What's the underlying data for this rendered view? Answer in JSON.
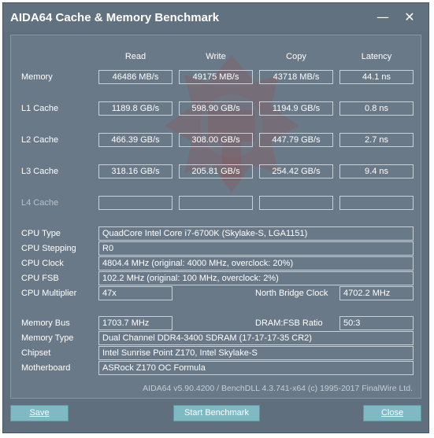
{
  "window": {
    "title": "AIDA64 Cache & Memory Benchmark",
    "minimize_glyph": "—",
    "close_glyph": "✕"
  },
  "columns": [
    "Read",
    "Write",
    "Copy",
    "Latency"
  ],
  "rows": [
    {
      "label": "Memory",
      "read": "46486 MB/s",
      "write": "49175 MB/s",
      "copy": "43718 MB/s",
      "latency": "44.1 ns"
    },
    {
      "label": "L1 Cache",
      "read": "1189.8 GB/s",
      "write": "598.90 GB/s",
      "copy": "1194.9 GB/s",
      "latency": "0.8 ns"
    },
    {
      "label": "L2 Cache",
      "read": "466.39 GB/s",
      "write": "308.00 GB/s",
      "copy": "447.79 GB/s",
      "latency": "2.7 ns"
    },
    {
      "label": "L3 Cache",
      "read": "318.16 GB/s",
      "write": "205.81 GB/s",
      "copy": "254.42 GB/s",
      "latency": "9.4 ns"
    },
    {
      "label": "L4 Cache",
      "read": "",
      "write": "",
      "copy": "",
      "latency": ""
    }
  ],
  "cpu": {
    "type_label": "CPU Type",
    "type_value": "QuadCore Intel Core i7-6700K  (Skylake-S, LGA1151)",
    "stepping_label": "CPU Stepping",
    "stepping_value": "R0",
    "clock_label": "CPU Clock",
    "clock_value": "4804.4 MHz  (original: 4000 MHz, overclock: 20%)",
    "fsb_label": "CPU FSB",
    "fsb_value": "102.2 MHz  (original: 100 MHz, overclock: 2%)",
    "multiplier_label": "CPU Multiplier",
    "multiplier_value": "47x",
    "nb_clock_label": "North Bridge Clock",
    "nb_clock_value": "4702.2 MHz"
  },
  "memory": {
    "bus_label": "Memory Bus",
    "bus_value": "1703.7 MHz",
    "ratio_label": "DRAM:FSB Ratio",
    "ratio_value": "50:3",
    "type_label": "Memory Type",
    "type_value": "Dual Channel DDR4-3400 SDRAM  (17-17-17-35 CR2)",
    "chipset_label": "Chipset",
    "chipset_value": "Intel Sunrise Point Z170, Intel Skylake-S",
    "mobo_label": "Motherboard",
    "mobo_value": "ASRock Z170 OC Formula"
  },
  "footer": "AIDA64 v5.90.4200 / BenchDLL 4.3.741-x64  (c) 1995-2017 FinalWire Ltd.",
  "buttons": {
    "save": "Save",
    "start": "Start Benchmark",
    "close": "Close"
  },
  "colors": {
    "window_bg": "#606f7e",
    "button_bg": "#7fb9c4"
  }
}
